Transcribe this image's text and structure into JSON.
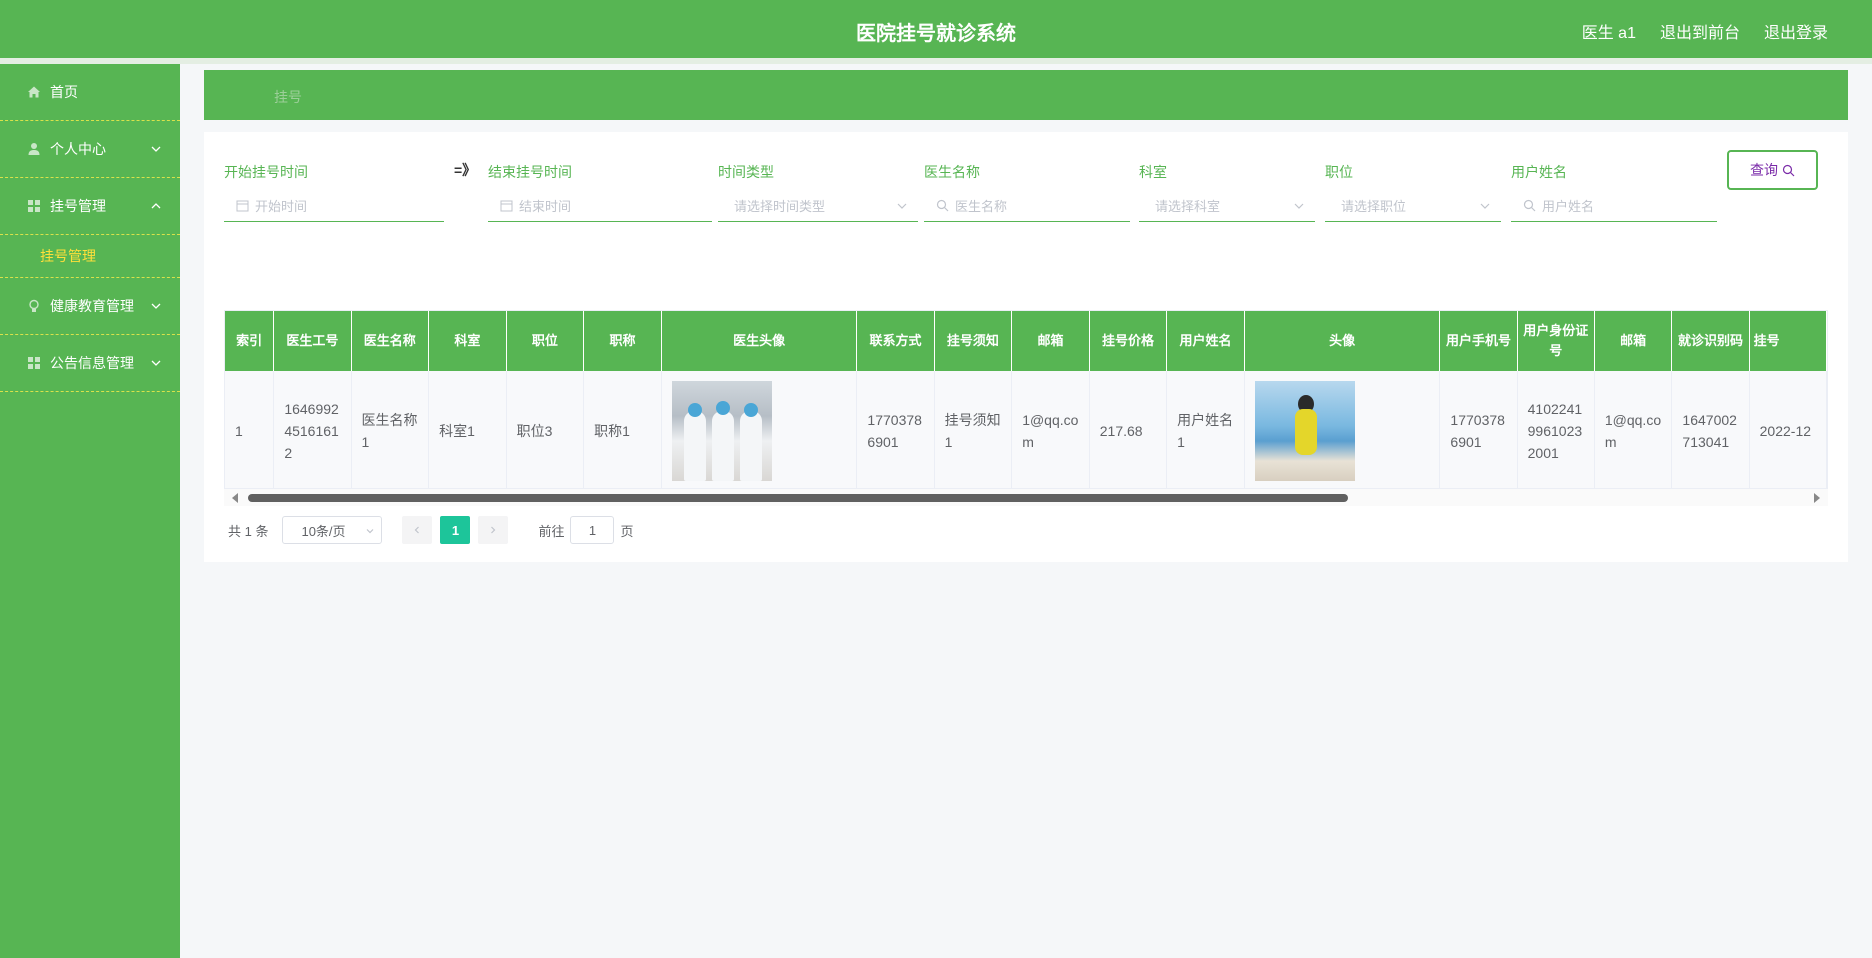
{
  "header": {
    "title": "医院挂号就诊系统",
    "user": "医生 a1",
    "to_front": "退出到前台",
    "logout": "退出登录"
  },
  "sidebar": {
    "items": [
      {
        "label": "首页"
      },
      {
        "label": "个人中心"
      },
      {
        "label": "挂号管理"
      },
      {
        "label": "挂号管理"
      },
      {
        "label": "健康教育管理"
      },
      {
        "label": "公告信息管理"
      }
    ]
  },
  "breadcrumb": "挂号",
  "filters": {
    "start_label": "开始挂号时间",
    "start_placeholder": "开始时间",
    "separator": "=》",
    "end_label": "结束挂号时间",
    "end_placeholder": "结束时间",
    "timetype_label": "时间类型",
    "timetype_placeholder": "请选择时间类型",
    "doctor_label": "医生名称",
    "doctor_placeholder": "医生名称",
    "dept_label": "科室",
    "dept_placeholder": "请选择科室",
    "position_label": "职位",
    "position_placeholder": "请选择职位",
    "username_label": "用户姓名",
    "username_placeholder": "用户姓名",
    "query_button": "查询"
  },
  "table": {
    "headers": [
      "索引",
      "医生工号",
      "医生名称",
      "科室",
      "职位",
      "职称",
      "医生头像",
      "联系方式",
      "挂号须知",
      "邮箱",
      "挂号价格",
      "用户姓名",
      "头像",
      "用户手机号",
      "用户身份证号",
      "邮箱",
      "就诊识别码",
      "挂号"
    ],
    "rows": [
      [
        "1",
        "16469924516161 2",
        "医生名称1",
        "科室1",
        "职位3",
        "职称1",
        "",
        "17703786901",
        "挂号须知1",
        "1@qq.com",
        "217.68",
        "用户姓名1",
        "",
        "17703786901",
        "410224199610232001",
        "1@qq.com",
        "1647002713041",
        "2022-12"
      ]
    ]
  },
  "pagination": {
    "total": "共 1 条",
    "page_size": "10条/页",
    "current_page": "1",
    "goto_label": "前往",
    "goto_value": "1",
    "page_suffix": "页"
  },
  "colors": {
    "primary_green": "#57b553",
    "active_submenu": "#ffe03a",
    "page_active": "#1dc59a"
  }
}
